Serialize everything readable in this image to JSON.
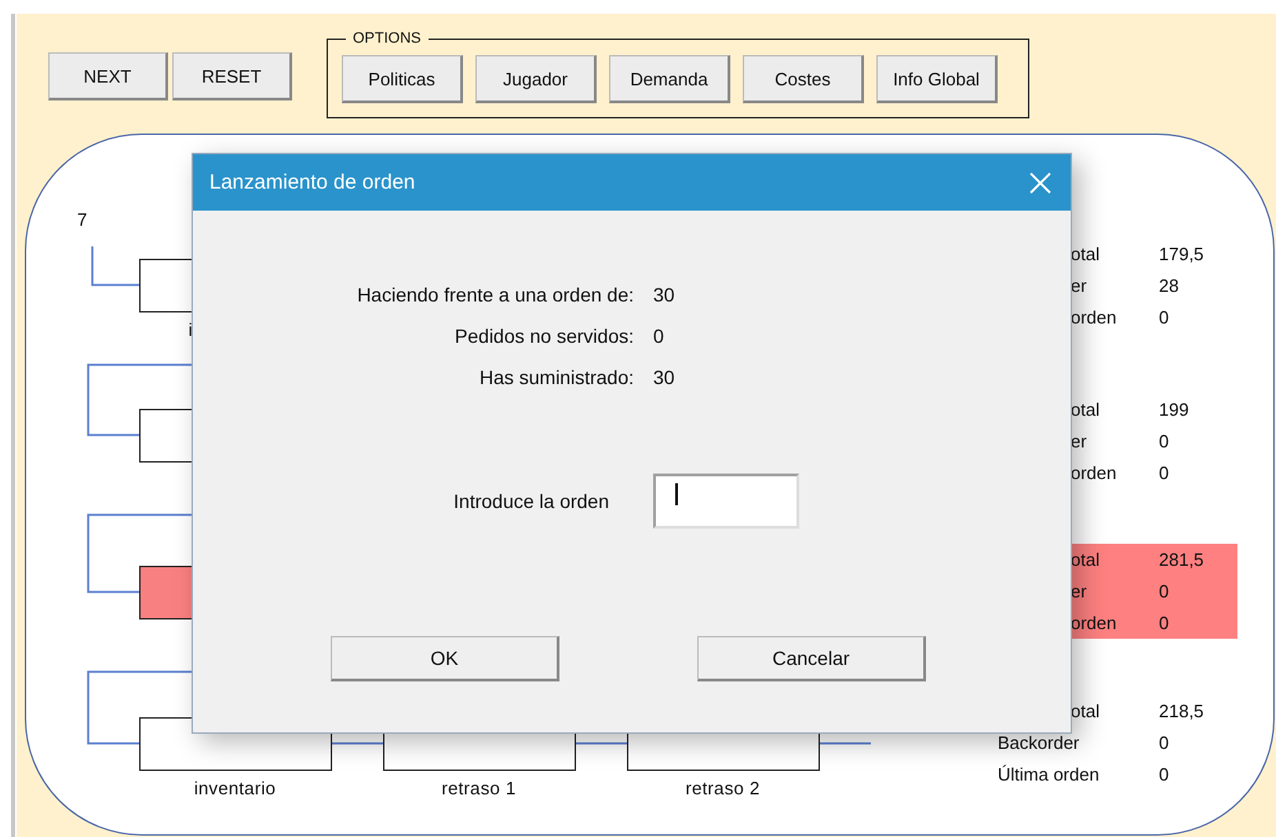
{
  "toolbar": {
    "buttons": [
      "NEXT",
      "RESET"
    ]
  },
  "options": {
    "title": "OPTIONS",
    "buttons": [
      "Politicas",
      "Jugador",
      "Demanda",
      "Costes",
      "Info Global"
    ]
  },
  "diagram": {
    "top_label": "7",
    "stages": [
      {
        "highlighted": false,
        "boxes": [
          {
            "kind": "stock",
            "caption": "i"
          }
        ],
        "stats": [
          {
            "label": "otal",
            "partly_hidden": true,
            "value": "179,5"
          },
          {
            "label": "er",
            "partly_hidden": true,
            "value": "28"
          },
          {
            "label": "orden",
            "partly_hidden": true,
            "value": "0"
          }
        ]
      },
      {
        "highlighted": false,
        "boxes": [
          {
            "kind": "stock"
          }
        ],
        "stats": [
          {
            "label": "otal",
            "partly_hidden": true,
            "value": "199"
          },
          {
            "label": "er",
            "partly_hidden": true,
            "value": "0"
          },
          {
            "label": "orden",
            "partly_hidden": true,
            "value": "0"
          }
        ]
      },
      {
        "highlighted": true,
        "boxes": [
          {
            "kind": "stock"
          }
        ],
        "stats": [
          {
            "label": "otal",
            "partly_hidden": true,
            "value": "281,5"
          },
          {
            "label": "er",
            "partly_hidden": true,
            "value": "0"
          },
          {
            "label": "orden",
            "partly_hidden": true,
            "value": "0"
          }
        ]
      },
      {
        "highlighted": false,
        "boxes": [
          {
            "kind": "stock",
            "caption": "inventario"
          },
          {
            "kind": "stock",
            "caption": "retraso 1"
          },
          {
            "kind": "stock",
            "caption": "retraso 2"
          }
        ],
        "stats": [
          {
            "label": "otal",
            "partly_hidden": true,
            "value": "218,5"
          },
          {
            "label": "Backorder",
            "partly_hidden": false,
            "value": "0"
          },
          {
            "label": "Última orden",
            "partly_hidden": false,
            "value": "0"
          }
        ]
      }
    ]
  },
  "dialog": {
    "title": "Lanzamiento de orden",
    "rows": [
      {
        "label": "Haciendo frente a una orden de:",
        "value": "30"
      },
      {
        "label": "Pedidos no servidos:",
        "value": "0"
      },
      {
        "label": "Has suministrado:",
        "value": "30"
      }
    ],
    "input": {
      "label": "Introduce la orden",
      "focused": true
    },
    "buttons": [
      "OK",
      "Cancelar"
    ]
  }
}
